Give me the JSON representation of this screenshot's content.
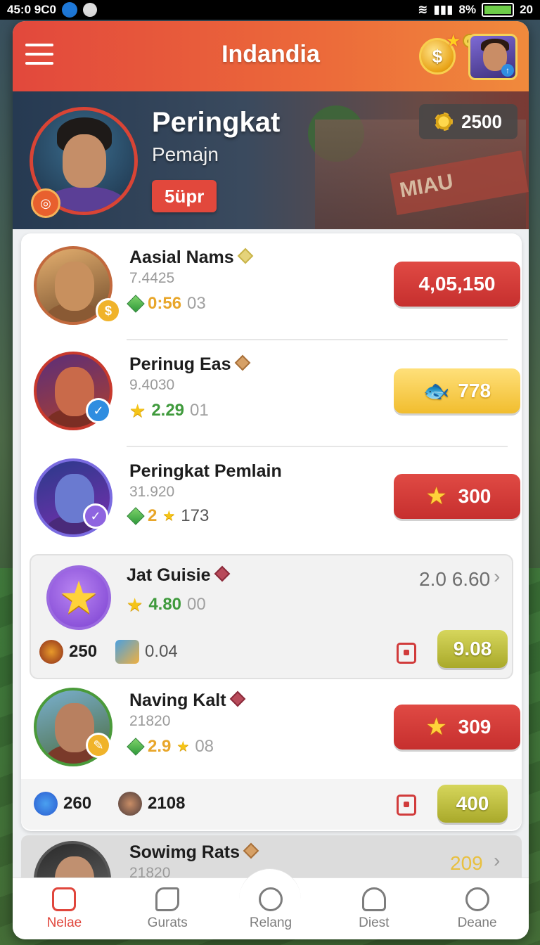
{
  "status_bar": {
    "time": "45:0 9C0",
    "battery_text": "8%",
    "clock": "20"
  },
  "header": {
    "title": "Indandia"
  },
  "profile": {
    "title": "Peringkat",
    "subtitle": "Pemajn",
    "rank_button": "5üpr",
    "score": "2500"
  },
  "leaderboard": [
    {
      "name": "Aasial Nams",
      "sub": "7.4425",
      "stat_value": "0:56",
      "stat_muted": "03",
      "button": "4,05,150",
      "button_style": "red",
      "stat_color": "#e8a62a"
    },
    {
      "name": "Perinug Eas",
      "sub": "9.4030",
      "stat_value": "2.29",
      "stat_muted": "01",
      "button": "778",
      "button_style": "gold",
      "stat_color": "#3f9a3c"
    },
    {
      "name": "Peringkat Pemlain",
      "sub": "31.920",
      "stat_value": "2",
      "stat_muted": "173",
      "button": "300",
      "button_style": "red",
      "stat_color": "#e8a62a"
    },
    {
      "name": "Jat Guisie",
      "sub": "",
      "stat_value": "4.80",
      "stat_muted": "00",
      "score": "2.0 6.60",
      "mini_left": "250",
      "mini_right": "0.04",
      "button": "9.08",
      "button_style": "olive",
      "stat_color": "#3f9a3c"
    },
    {
      "name": "Naving Kalt",
      "sub": "21820",
      "stat_value": "2.9",
      "stat_muted": "08",
      "button": "309",
      "button_style": "red",
      "stat_color": "#e8a62a",
      "mini_left": "260",
      "mini_right": "2108",
      "button2": "400"
    },
    {
      "name": "Sowimg Rats",
      "sub": "21820",
      "score": "209"
    }
  ],
  "nav": [
    {
      "label": "Nelae",
      "icon": "shield-heart-icon",
      "active": true
    },
    {
      "label": "Gurats",
      "icon": "map-icon",
      "active": false
    },
    {
      "label": "Relang",
      "icon": "close-circle-icon",
      "active": false
    },
    {
      "label": "Diest",
      "icon": "users-icon",
      "active": false
    },
    {
      "label": "Deane",
      "icon": "compass-icon",
      "active": false
    }
  ],
  "colors": {
    "primary": "#e2483c",
    "gold": "#f1bd2e",
    "olive": "#a9a92a"
  }
}
